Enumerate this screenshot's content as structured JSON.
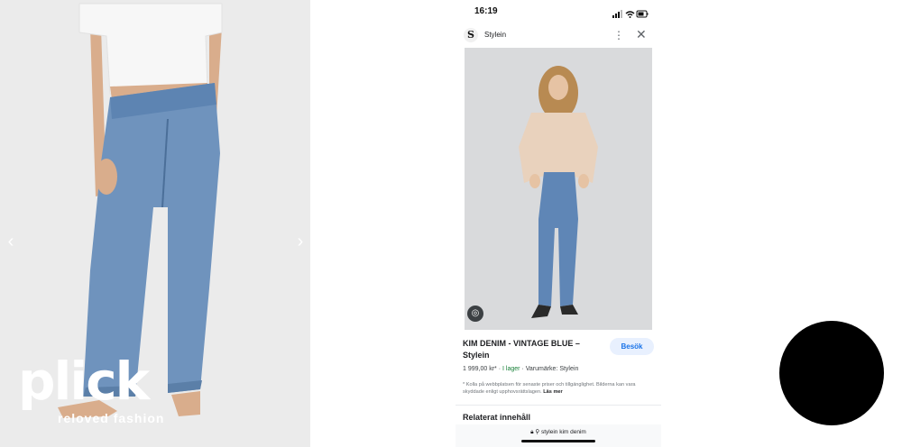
{
  "left_panel": {
    "prev_arrow": "‹",
    "next_arrow": "›",
    "logo": {
      "word": "plick",
      "tagline": "reloved fashion"
    }
  },
  "phone": {
    "status": {
      "time": "16:19"
    },
    "chrome": {
      "favicon_letter": "S",
      "site_name": "Stylein",
      "more_glyph": "⋮",
      "close_glyph": "✕"
    },
    "product": {
      "title": "KIM DENIM - VINTAGE BLUE – Stylein",
      "visit_label": "Besök",
      "price": "1 999,00 kr*",
      "separator": "·",
      "stock": "I lager",
      "brand": "Varumärke: Stylein",
      "disclaimer": "* Kolla på webbplatsen för senaste priser och tillgänglighet. Bilderna kan vara skyddade enligt upphovsrättslagen.",
      "read_more": "Läs mer"
    },
    "related": {
      "title": "Relaterat innehåll"
    },
    "search": {
      "query": "stylein kim denim"
    }
  },
  "colors": {
    "accent_blue": "#1a73e8",
    "stock_green": "#188038",
    "overlay": "#000000"
  }
}
